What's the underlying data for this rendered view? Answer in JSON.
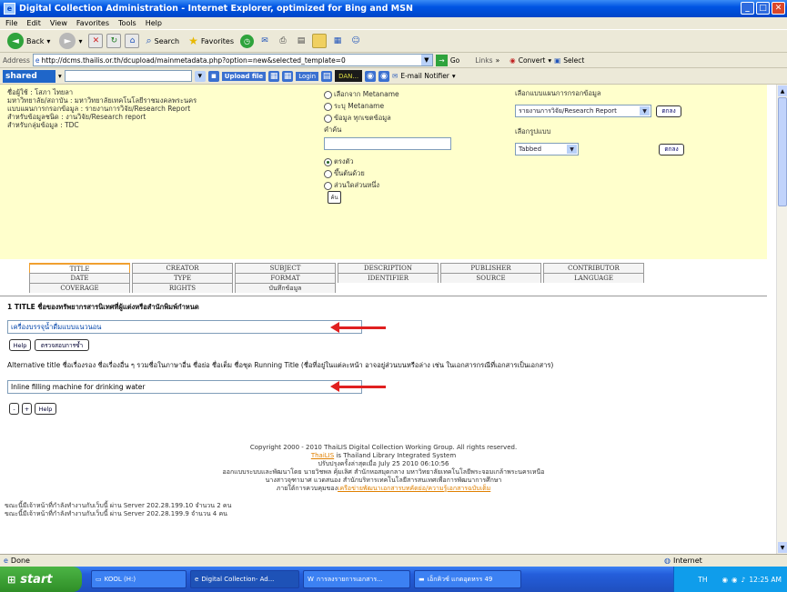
{
  "window": {
    "title": "Digital Collection Administration - Internet Explorer, optimized for Bing and MSN"
  },
  "menu": [
    "File",
    "Edit",
    "View",
    "Favorites",
    "Tools",
    "Help"
  ],
  "toolbar": {
    "back": "Back",
    "search": "Search",
    "favorites": "Favorites"
  },
  "address": {
    "label": "Address",
    "url": "http://dcms.thailis.or.th/dcupload/mainmetadata.php?option=new&selected_template=0",
    "go": "Go",
    "links": "Links",
    "convert": "Convert",
    "select": "Select"
  },
  "linksbar": {
    "shared": "shared",
    "upload": "Upload file",
    "login": "Login",
    "dark": "DAN...",
    "email": "E-mail Notifier"
  },
  "user": {
    "lines": [
      "ชื่อผู้ใช้ : โสภา ไทยลา",
      "มหาวิทยาลัย/สถาบัน : มหาวิทยาลัยเทคโนโลยีราชมงคลพระนคร",
      "แบบแผนการกรอกข้อมูล : รายงานการวิจัย/Research Report",
      "สำหรับข้อมูลชนิด : งานวิจัย/Research report",
      "สำหรับกลุ่มข้อมูล : TDC"
    ]
  },
  "search": {
    "options": [
      "เลือกจาก Metaname",
      "ระบุ Metaname",
      "ข้อมูล ทุกเขตข้อมูล"
    ],
    "keyword_label": "คำค้น",
    "match_options": [
      "ตรงตัว",
      "ขึ้นต้นด้วย",
      "ส่วนใดส่วนหนึ่ง"
    ],
    "search_btn": "ค้น"
  },
  "template": {
    "label": "เลือกแบบแผนการกรอกข้อมูล",
    "value": "รายงานการวิจัย/Research Report",
    "ok": "ตกลง",
    "format_label": "เลือกรูปแบบ",
    "format_value": "Tabbed",
    "ok2": "ตกลง"
  },
  "tabs": [
    [
      "TITLE",
      "CREATOR",
      "SUBJECT",
      "DESCRIPTION",
      "PUBLISHER",
      "CONTRIBUTOR"
    ],
    [
      "DATE",
      "TYPE",
      "FORMAT",
      "IDENTIFIER",
      "SOURCE",
      "LANGUAGE"
    ],
    [
      "COVERAGE",
      "RIGHTS",
      "บันทึกข้อมูล"
    ]
  ],
  "form": {
    "title_label": "1 TITLE ชื่อของทรัพยากรสารนิเทศที่ผู้แต่งหรือสำนักพิมพ์กำหนด",
    "title_value": "เครื่องบรรจุน้ำดื่มแบบแนวนอน",
    "help": "Help",
    "check": "ตรวจสอบการซ้ำ",
    "alt_label": "Alternative title ชื่อเรื่องรอง ชื่อเรื่องอื่น ๆ รวมชื่อในภาษาอื่น ชื่อย่อ ชื่อเต็ม ชื่อชุด Running Title (ชื่อที่อยู่ในแต่ละหน้า อาจอยู่ส่วนบนหรือล่าง เช่น ในเอกสารกรณีที่เอกสารเป็นเอกสาร)",
    "alt_value": "Inline filling machine for drinking water",
    "minus": "-",
    "plus": "+",
    "help2": "Help"
  },
  "footer": {
    "copyright": "Copyright 2000 - 2010 ThaiLIS Digital Collection Working Group. All rights reserved.",
    "thailis": "ThaiLIS",
    "thailis_rest": " is Thailand Library Integrated System",
    "updated": "ปรับปรุงครั้งล่าสุดเมื่อ July 25 2010 06:10:56",
    "designed": "ออกแบบระบบและพัฒนาโดย นายวิชพล คุ้มเลิศ สำนักหอสมุดกลาง มหาวิทยาลัยเทคโนโลยีพระจอมเกล้าพระนครเหนือ",
    "designed2": "นางสาวจุฑามาศ แวดสนอง สำนักบริหารเทคโนโลยีสารสนเทศเพื่อการพัฒนาการศึกษา",
    "support_pre": "ภายใต้การควบคุมของ",
    "support_link": "เครือข่ายพัฒนาเอกสารบทคัดย่อ/ความรู้เอกสารฉบับเต็ม"
  },
  "servers": [
    "ขณะนี้มีเจ้าหน้าที่กำลังทำงานกับเว็บนี้ ผ่าน Server 202.28.199.10 จำนวน 2 คน",
    "ขณะนี้มีเจ้าหน้าที่กำลังทำงานกับเว็บนี้ ผ่าน Server 202.28.199.9 จำนวน 4 คน"
  ],
  "status": {
    "text": "Done",
    "zone": "Internet"
  },
  "taskbar": {
    "start": "start",
    "tasks": [
      "KOOL (H:)",
      "Digital Collection- Ad...",
      "การลงรายการเอกสาร...",
      "เอ็กคิวซ์ แกดอุดหรร 49"
    ],
    "lang": "TH",
    "time": "12:25 AM"
  }
}
